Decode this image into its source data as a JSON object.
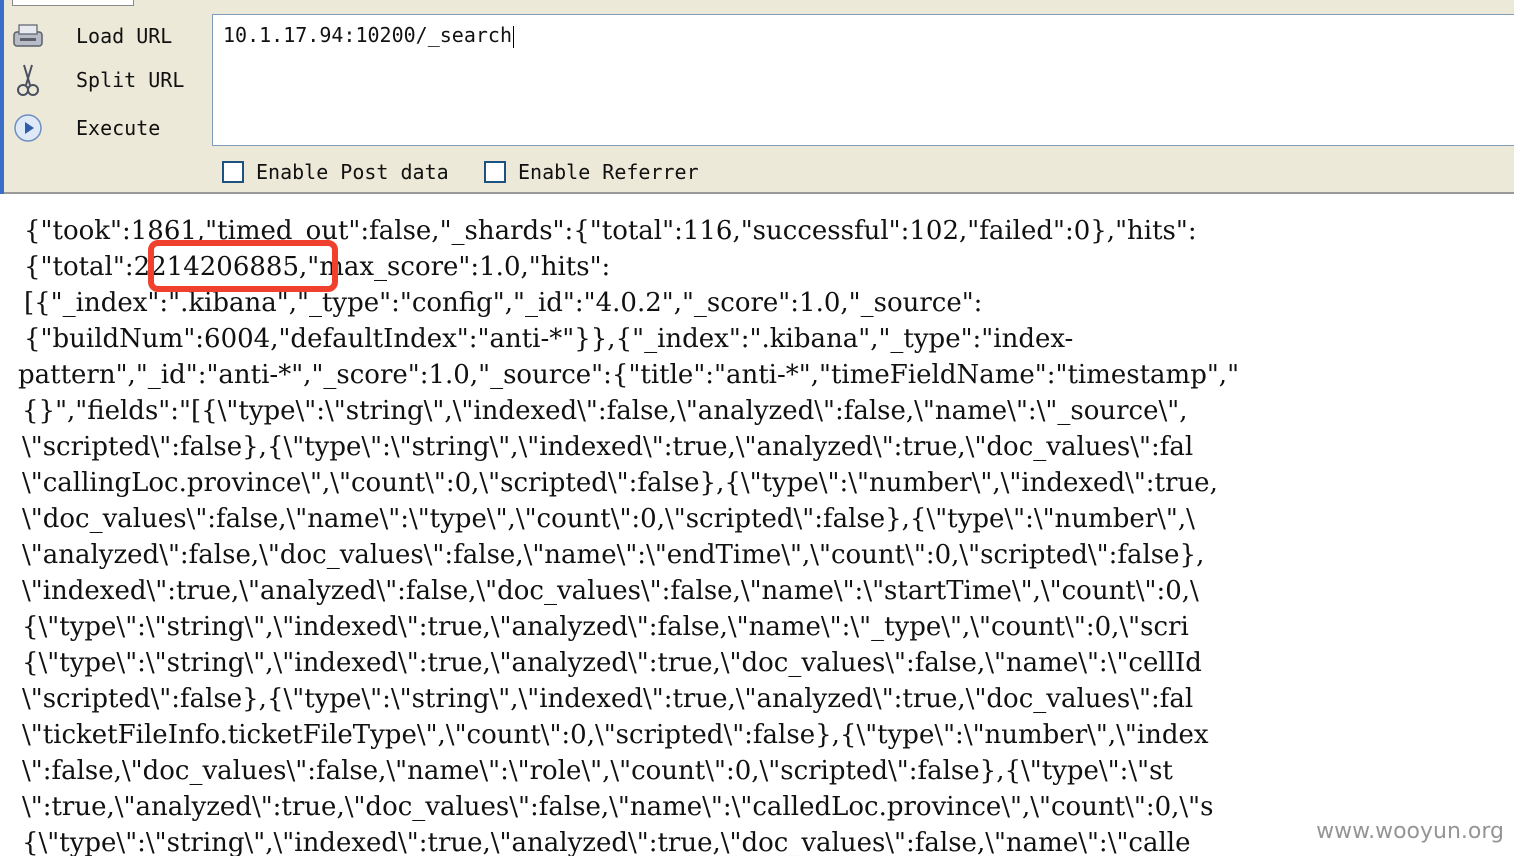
{
  "toolbar": {
    "load_url_label": "Load URL",
    "split_url_label": "Split URL",
    "execute_label": "Execute",
    "url_value": "10.1.17.94:10200/_search",
    "enable_post_label": "Enable Post data",
    "enable_referrer_label": "Enable Referrer",
    "enable_post_checked": false,
    "enable_referrer_checked": false
  },
  "response": {
    "lines": [
      "{\"took\":1861,\"timed_out\":false,\"_shards\":{\"total\":116,\"successful\":102,\"failed\":0},\"hits\":",
      "{\"total\":2214206885,\"max_score\":1.0,\"hits\":",
      "[{\"_index\":\".kibana\",\"_type\":\"config\",\"_id\":\"4.0.2\",\"_score\":1.0,\"_source\":",
      "{\"buildNum\":6004,\"defaultIndex\":\"anti-*\"}},{\"_index\":\".kibana\",\"_type\":\"index-",
      "pattern\",\"_id\":\"anti-*\",\"_score\":1.0,\"_source\":{\"title\":\"anti-*\",\"timeFieldName\":\"timestamp\",\"",
      "{}\",\"fields\":\"[{\\\"type\\\":\\\"string\\\",\\\"indexed\\\":false,\\\"analyzed\\\":false,\\\"name\\\":\\\"_source\\\",",
      "\\\"scripted\\\":false},{\\\"type\\\":\\\"string\\\",\\\"indexed\\\":true,\\\"analyzed\\\":true,\\\"doc_values\\\":fal",
      "\\\"callingLoc.province\\\",\\\"count\\\":0,\\\"scripted\\\":false},{\\\"type\\\":\\\"number\\\",\\\"indexed\\\":true,",
      "\\\"doc_values\\\":false,\\\"name\\\":\\\"type\\\",\\\"count\\\":0,\\\"scripted\\\":false},{\\\"type\\\":\\\"number\\\",\\",
      "\\\"analyzed\\\":false,\\\"doc_values\\\":false,\\\"name\\\":\\\"endTime\\\",\\\"count\\\":0,\\\"scripted\\\":false},",
      "\\\"indexed\\\":true,\\\"analyzed\\\":false,\\\"doc_values\\\":false,\\\"name\\\":\\\"startTime\\\",\\\"count\\\":0,\\",
      "{\\\"type\\\":\\\"string\\\",\\\"indexed\\\":true,\\\"analyzed\\\":false,\\\"name\\\":\\\"_type\\\",\\\"count\\\":0,\\\"scri",
      "{\\\"type\\\":\\\"string\\\",\\\"indexed\\\":true,\\\"analyzed\\\":true,\\\"doc_values\\\":false,\\\"name\\\":\\\"cellId",
      "\\\"scripted\\\":false},{\\\"type\\\":\\\"string\\\",\\\"indexed\\\":true,\\\"analyzed\\\":true,\\\"doc_values\\\":fal",
      "\\\"ticketFileInfo.ticketFileType\\\",\\\"count\\\":0,\\\"scripted\\\":false},{\\\"type\\\":\\\"number\\\",\\\"index",
      "\\\":false,\\\"doc_values\\\":false,\\\"name\\\":\\\"role\\\",\\\"count\\\":0,\\\"scripted\\\":false},{\\\"type\\\":\\\"st",
      "\\\":true,\\\"analyzed\\\":true,\\\"doc_values\\\":false,\\\"name\\\":\\\"calledLoc.province\\\",\\\"count\\\":0,\\\"s",
      "{\\\"type\\\":\\\"string\\\",\\\"indexed\\\":true,\\\"analyzed\\\":true,\\\"doc_values\\\":false,\\\"name\\\":\\\"calle"
    ]
  },
  "watermark": "www.wooyun.org",
  "colors": {
    "highlight": "#f0412f",
    "toolbar_bg": "#ece9d8"
  }
}
